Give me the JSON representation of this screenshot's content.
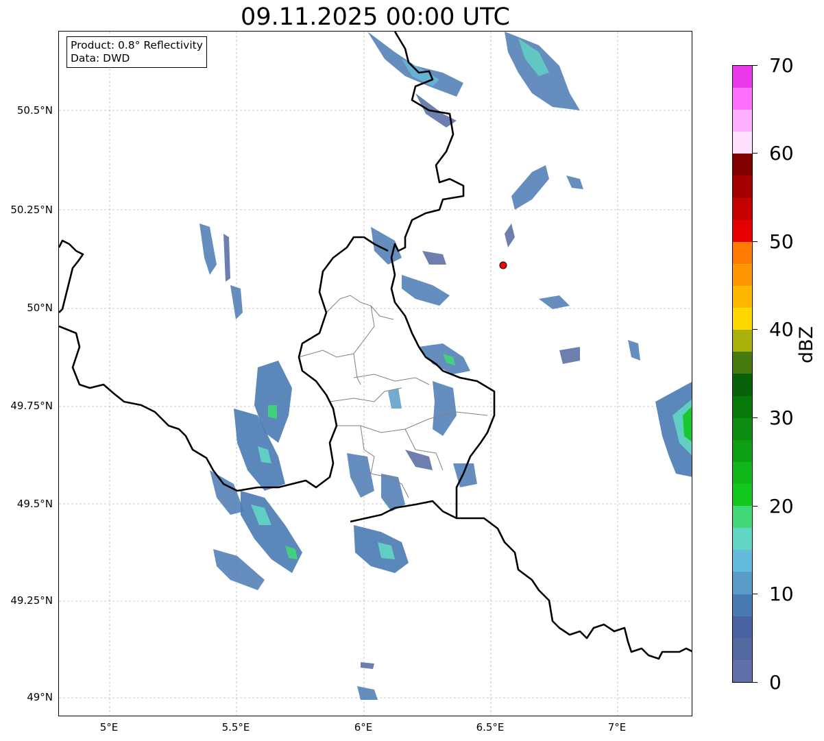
{
  "title": "09.11.2025 00:00 UTC",
  "info": {
    "product_line": "Product: 0.8° Reflectivity",
    "data_line": "Data: DWD"
  },
  "axes": {
    "lat_labels": [
      "50.5°N",
      "50.25°N",
      "50°N",
      "49.75°N",
      "49.5°N",
      "49.25°N",
      "49°N"
    ],
    "lon_labels": [
      "5°E",
      "5.5°E",
      "6°E",
      "6.5°E",
      "7°E"
    ],
    "lat_range": [
      48.95,
      50.7
    ],
    "lon_range": [
      4.8,
      7.3
    ]
  },
  "marker": {
    "lat": 50.11,
    "lon": 6.55,
    "color": "#ff0000"
  },
  "colorbar": {
    "label": "dBZ",
    "tick_labels": [
      "0",
      "10",
      "20",
      "30",
      "40",
      "50",
      "60",
      "70"
    ],
    "colors": [
      "#6070a8",
      "#5468a0",
      "#4862a2",
      "#4a7ab4",
      "#5a9cc8",
      "#64bcdc",
      "#62d6c4",
      "#40d878",
      "#12c81e",
      "#12b81a",
      "#0ea014",
      "#0c8c10",
      "#087a0c",
      "#08620a",
      "#467a0c",
      "#aab00a",
      "#ffd800",
      "#ffb800",
      "#ff9800",
      "#ff7c00",
      "#e40000",
      "#c40000",
      "#a40000",
      "#800000",
      "#ffe0ff",
      "#ffb0ff",
      "#ff70ff",
      "#ea38ea"
    ]
  }
}
